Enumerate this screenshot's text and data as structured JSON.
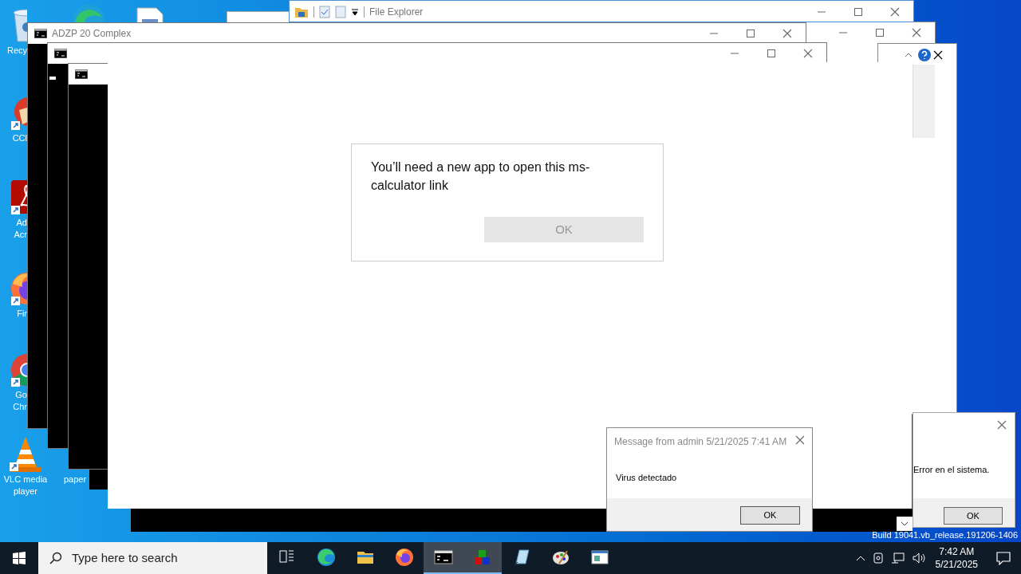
{
  "desktop_icons": [
    {
      "kind": "recycle",
      "lines": [
        "Recy"
      ]
    },
    {
      "kind": "ccleaner",
      "lines": [
        "CCl"
      ]
    },
    {
      "kind": "acrobat",
      "lines": [
        "Ad",
        "Acr"
      ]
    },
    {
      "kind": "firefox",
      "lines": [
        "Fir"
      ]
    },
    {
      "kind": "chrome",
      "lines": [
        "Go",
        "Chr"
      ]
    },
    {
      "kind": "vlc",
      "lines": [
        "VLC media",
        "player"
      ]
    },
    {
      "kind": "file",
      "lines": [
        "paper"
      ]
    }
  ],
  "file_explorer": {
    "title": "File Explorer"
  },
  "console_window": {
    "title": "ADZP 20 Complex"
  },
  "app_prompt": {
    "message": "You’ll need a new app to open this ms-calculator link",
    "button": "OK",
    "disabled": true
  },
  "error_dialog": {
    "message": "Error en el sistema.",
    "button": "OK"
  },
  "message_dialog": {
    "title": "Message from admin 5/21/2025 7:41 AM",
    "message": "Virus detectado",
    "button": "OK"
  },
  "build_text": "Build 19041.vb_release.191206-1406",
  "taskbar": {
    "search_placeholder": "Type here to search",
    "time": "7:42 AM",
    "date": "5/21/2025",
    "apps": [
      {
        "kind": "taskview",
        "active": false
      },
      {
        "kind": "edge",
        "active": false
      },
      {
        "kind": "explorer",
        "active": false
      },
      {
        "kind": "firefox",
        "active": false
      },
      {
        "kind": "console",
        "active": true
      },
      {
        "kind": "cubes",
        "active": true
      },
      {
        "kind": "notepad",
        "active": false
      },
      {
        "kind": "paint",
        "active": false
      },
      {
        "kind": "window",
        "active": false
      }
    ]
  }
}
